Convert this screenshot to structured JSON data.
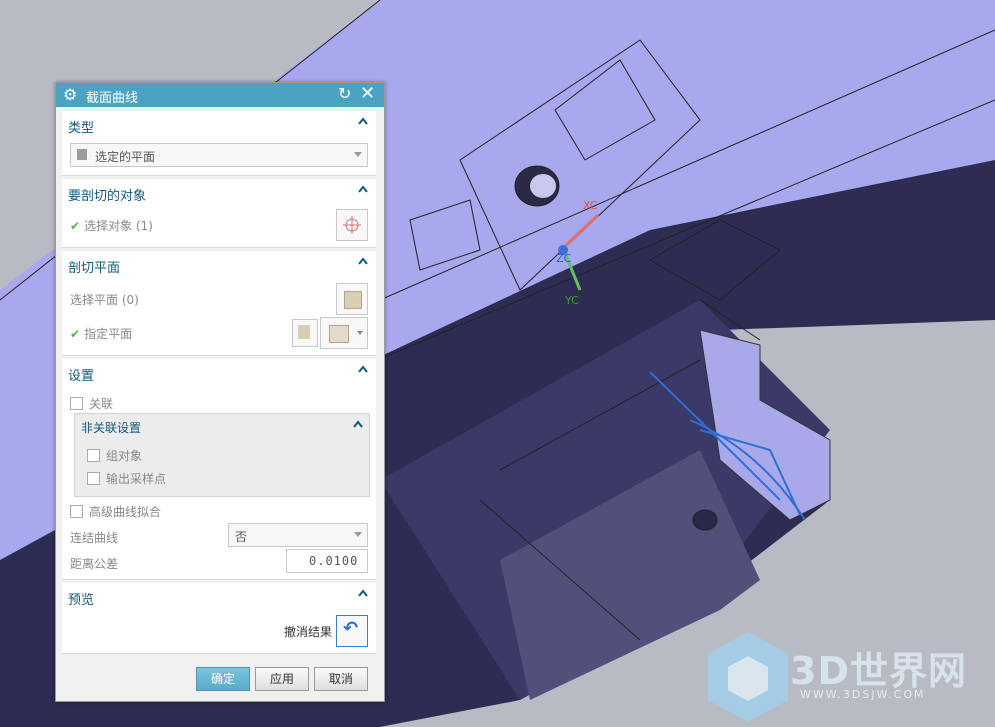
{
  "dialog": {
    "title": "截面曲线",
    "sections": {
      "type": {
        "header": "类型",
        "combo_value": "选定的平面"
      },
      "object": {
        "header": "要剖切的对象",
        "select_label": "选择对象 (1)"
      },
      "plane": {
        "header": "剖切平面",
        "select_plane": "选择平面 (0)",
        "specify_plane": "指定平面"
      },
      "settings": {
        "header": "设置",
        "associative": "关联",
        "nonassoc_header": "非关联设置",
        "group_objects": "组对象",
        "output_samples": "输出采样点",
        "advanced_fit": "高级曲线拟合",
        "join_curves_label": "连结曲线",
        "join_curves_value": "否",
        "distance_tol_label": "距离公差",
        "distance_tol_value": "0.0100"
      },
      "preview": {
        "header": "预览",
        "undo_label": "撤消结果"
      }
    },
    "buttons": {
      "ok": "确定",
      "apply": "应用",
      "cancel": "取消"
    }
  },
  "viewport": {
    "axis_x": "XC",
    "axis_z": "ZC",
    "axis_y": "YC"
  },
  "watermark": {
    "text": "3D世界网",
    "url": "WWW.3DSJW.COM"
  },
  "colors": {
    "title_bar": "#4aa3c2",
    "model": "#a6a6f0",
    "section_curve": "#2f6fd6",
    "primary_button": "#6cb6d3"
  }
}
